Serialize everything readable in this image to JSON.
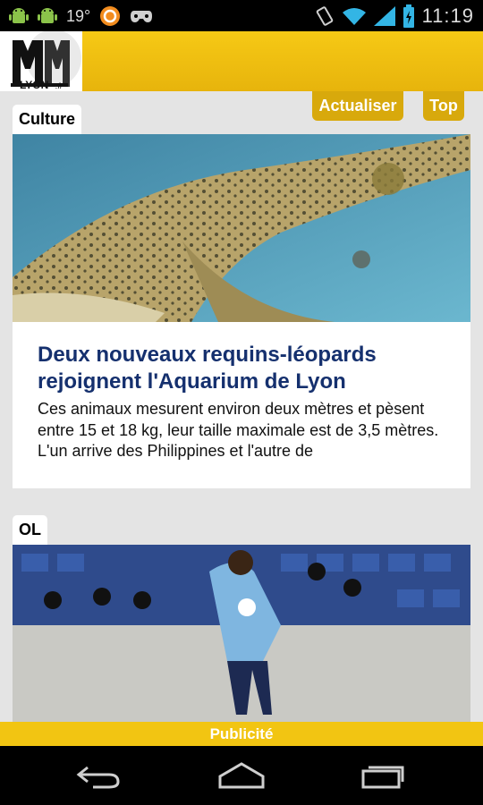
{
  "status_bar": {
    "temperature": "19°",
    "time": "11:19",
    "icons": [
      "android-icon",
      "android-icon",
      "circle-app-icon",
      "gamepad-icon",
      "vibrate-icon",
      "wifi-icon",
      "signal-icon",
      "battery-icon"
    ]
  },
  "header": {
    "logo_text": "LYON",
    "logo_suffix": ".fr",
    "refresh_label": "Actualiser",
    "top_label": "Top"
  },
  "articles": [
    {
      "category": "Culture",
      "title": "Deux nouveaux requins-léopards rejoignent l'Aquarium de Lyon",
      "excerpt": "Ces animaux mesurent environ deux mètres et pèsent entre 15 et 18 kg, leur taille maximale est de 3,5 mètres. L'un arrive des Philippines et l'autre de"
    },
    {
      "category": "OL"
    }
  ],
  "ad_label": "Publicité",
  "colors": {
    "accent": "#f2c512",
    "button": "#d8a90c",
    "title": "#15306e"
  }
}
